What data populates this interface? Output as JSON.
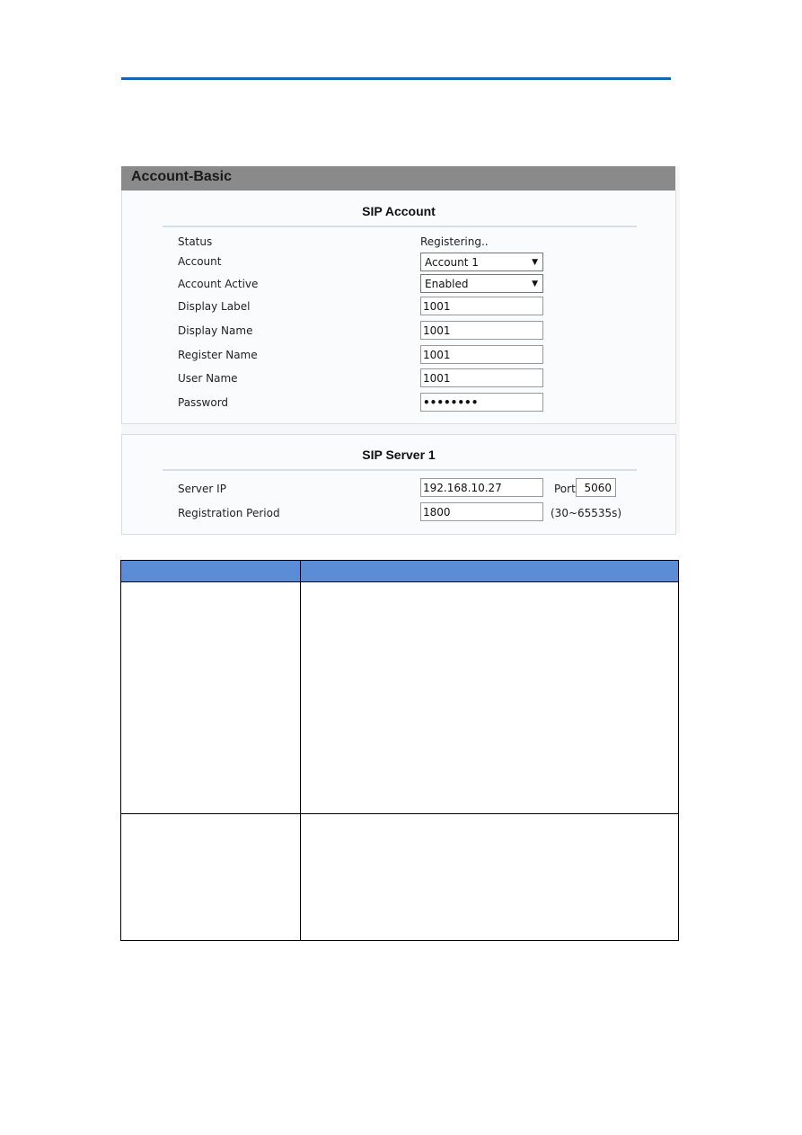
{
  "screenshot": {
    "header": "Account-Basic",
    "sip_account": {
      "title": "SIP Account",
      "status_label": "Status",
      "status_value": "Registering..",
      "account_label": "Account",
      "account_value": "Account 1",
      "active_label": "Account Active",
      "active_value": "Enabled",
      "display_label_label": "Display Label",
      "display_label_value": "1001",
      "display_name_label": "Display Name",
      "display_name_value": "1001",
      "register_name_label": "Register Name",
      "register_name_value": "1001",
      "user_name_label": "User Name",
      "user_name_value": "1001",
      "password_label": "Password",
      "password_value": "••••••••"
    },
    "sip_server": {
      "title": "SIP Server 1",
      "server_ip_label": "Server IP",
      "server_ip_value": "192.168.10.27",
      "port_label": "Port",
      "port_value": "5060",
      "period_label": "Registration Period",
      "period_value": "1800",
      "period_hint": "(30~65535s)"
    }
  },
  "colors": {
    "rule": "#1565b0",
    "table_header": "#5b8dd6",
    "header_bar": "#8a8a8a"
  }
}
